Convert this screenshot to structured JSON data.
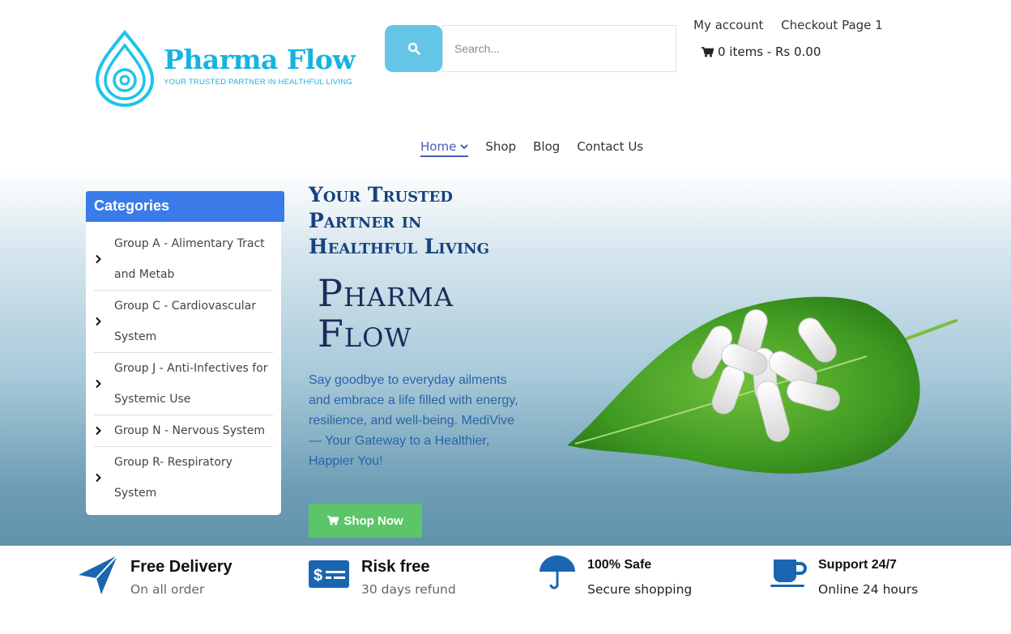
{
  "brand": {
    "name": "Pharma Flow",
    "tagline": "YOUR TRUSTED PARTNER IN HEALTHFUL LIVING"
  },
  "search": {
    "placeholder": "Search..."
  },
  "top_links": [
    "My account",
    "Checkout Page 1"
  ],
  "cart": {
    "text": "0 items - Rs 0.00"
  },
  "nav": {
    "items": [
      "Home",
      "Shop",
      "Blog",
      "Contact Us"
    ],
    "active": "Home"
  },
  "categories": {
    "heading": "Categories",
    "items": [
      "Group A - Alimentary Tract and Metab",
      "Group C - Cardiovascular System",
      "Group J - Anti-Infectives for Systemic Use",
      "Group N - Nervous System",
      "Group R- Respiratory System"
    ]
  },
  "hero": {
    "title": "Your Trusted Partner in Healthful Living",
    "brand_big": "Pharma Flow",
    "description": "Say goodbye to everyday ailments and embrace a life filled with energy, resilience, and well-being. MediVive — Your Gateway to a Healthier, Happier You!",
    "button": "Shop Now"
  },
  "features": [
    {
      "title": "Free Delivery",
      "subtitle": "On all order",
      "icon": "paper-plane-icon"
    },
    {
      "title": "Risk free",
      "subtitle": "30 days refund",
      "icon": "dollar-card-icon"
    },
    {
      "title": "100% Safe",
      "subtitle": "Secure shopping",
      "icon": "umbrella-icon"
    },
    {
      "title": "Support 24/7",
      "subtitle": "Online 24 hours",
      "icon": "coffee-cup-icon"
    }
  ],
  "colors": {
    "brand": "#17b3e0",
    "category_header": "#3b7be9",
    "shop_button": "#5cc569",
    "hero_title": "#17437e",
    "feature_icon": "#1b66b0"
  }
}
